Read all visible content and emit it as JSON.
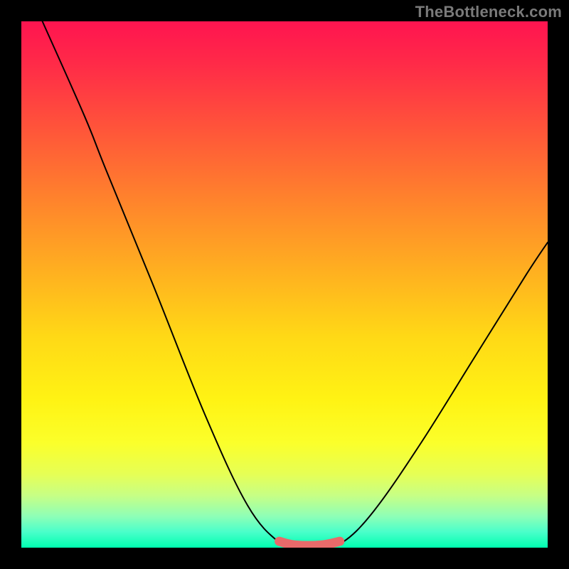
{
  "watermark": "TheBottleneck.com",
  "chart_data": {
    "type": "line",
    "title": "",
    "xlabel": "",
    "ylabel": "",
    "xlim": [
      0,
      100
    ],
    "ylim": [
      0,
      100
    ],
    "series": [
      {
        "name": "curve",
        "color": "#000000",
        "points": [
          {
            "x": 4,
            "y": 100
          },
          {
            "x": 12,
            "y": 82
          },
          {
            "x": 16,
            "y": 72
          },
          {
            "x": 25,
            "y": 50
          },
          {
            "x": 35,
            "y": 25
          },
          {
            "x": 43,
            "y": 8
          },
          {
            "x": 49,
            "y": 1
          },
          {
            "x": 52,
            "y": 0.5
          },
          {
            "x": 57,
            "y": 0.5
          },
          {
            "x": 61,
            "y": 1
          },
          {
            "x": 67,
            "y": 7
          },
          {
            "x": 76,
            "y": 20
          },
          {
            "x": 86,
            "y": 36
          },
          {
            "x": 96,
            "y": 52
          },
          {
            "x": 100,
            "y": 58
          }
        ]
      },
      {
        "name": "highlight",
        "color": "#e86a6a",
        "points": [
          {
            "x": 49,
            "y": 1.2
          },
          {
            "x": 52,
            "y": 0.5
          },
          {
            "x": 57,
            "y": 0.5
          },
          {
            "x": 60.5,
            "y": 1.2
          }
        ]
      }
    ]
  }
}
